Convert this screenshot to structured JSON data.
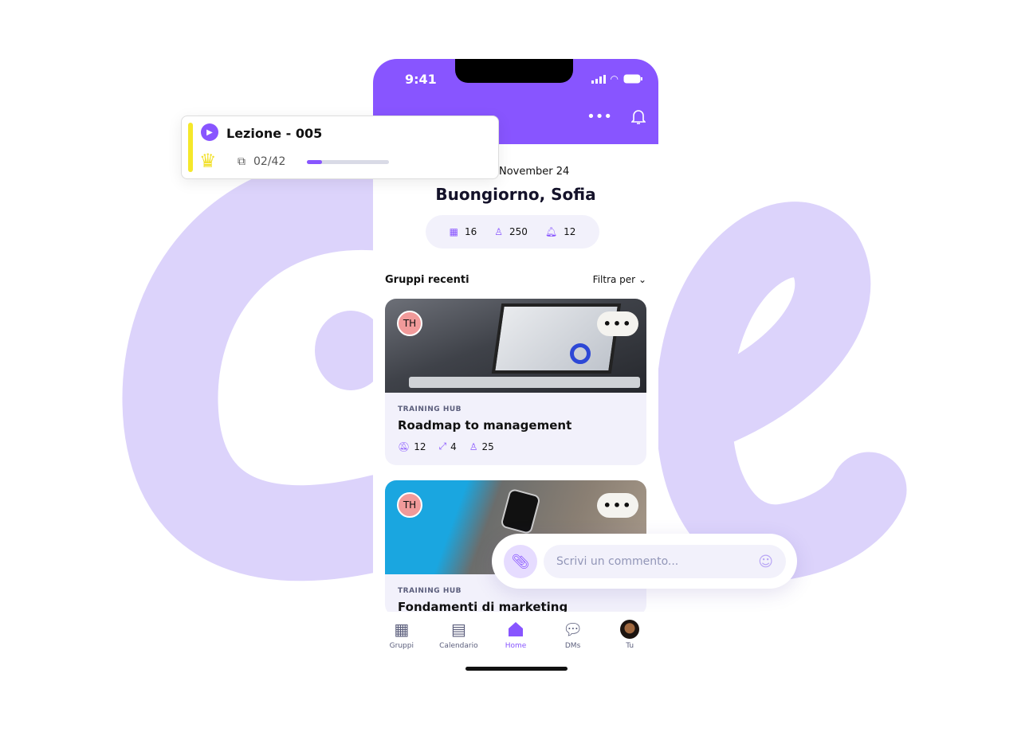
{
  "status_bar": {
    "time": "9:41"
  },
  "home": {
    "date": "November 24",
    "greeting": "Buongiorno, Sofia",
    "stats": {
      "groups": "16",
      "members": "250",
      "notifications": "12"
    }
  },
  "section": {
    "title": "Gruppi recenti",
    "filter": "Filtra per"
  },
  "cards": [
    {
      "avatar": "TH",
      "category": "TRAINING HUB",
      "title": "Roadmap to management",
      "notifications": "12",
      "workouts": "4",
      "members": "25"
    },
    {
      "avatar": "TH",
      "category": "TRAINING HUB",
      "title": "Fondamenti di marketing"
    }
  ],
  "tabs": [
    {
      "label": "Gruppi"
    },
    {
      "label": "Calendario"
    },
    {
      "label": "Home",
      "active": true
    },
    {
      "label": "DMs"
    },
    {
      "label": "Tu"
    }
  ],
  "lesson": {
    "title": "Lezione - 005",
    "pages": "02/42",
    "progress": 0.18
  },
  "comment": {
    "placeholder": "Scrivi un commento..."
  },
  "colors": {
    "accent": "#8855ff",
    "background_letters": "#dcd3fb",
    "crown": "#f2e02a"
  }
}
